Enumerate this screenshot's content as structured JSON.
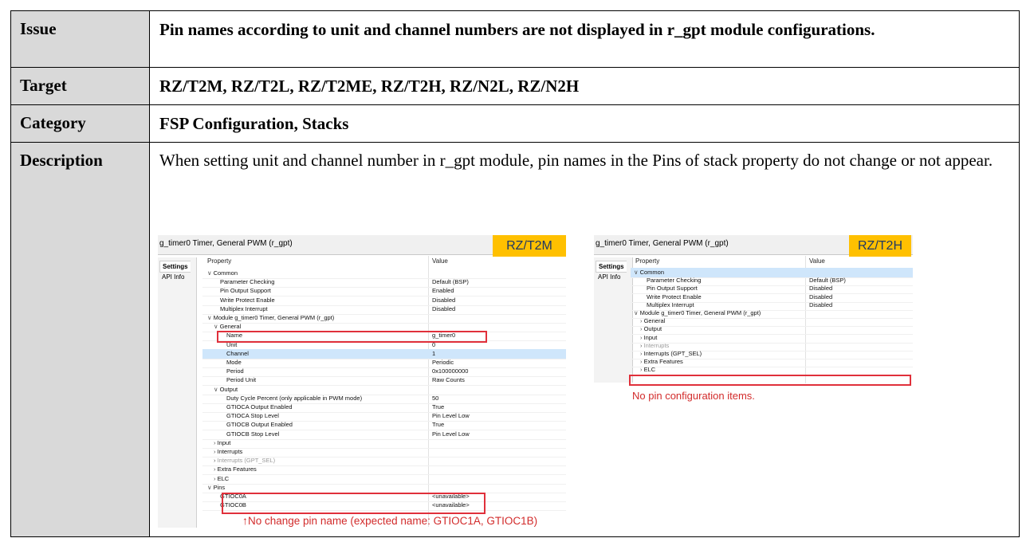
{
  "rows": {
    "issue": {
      "label": "Issue",
      "value": "Pin names according to unit and channel numbers are not displayed in r_gpt module configurations."
    },
    "target": {
      "label": "Target",
      "value": "RZ/T2M, RZ/T2L, RZ/T2ME, RZ/T2H, RZ/N2L, RZ/N2H"
    },
    "category": {
      "label": "Category",
      "value": "FSP Configuration, Stacks"
    },
    "description": {
      "label": "Description",
      "value": "When setting unit and channel number in r_gpt module, pin names in the Pins of stack property do not change or not appear."
    }
  },
  "left_panel": {
    "title": "g_timer0 Timer, General PWM (r_gpt)",
    "badge": "RZ/T2M",
    "tabs": [
      "Settings",
      "API Info"
    ],
    "col_property": "Property",
    "col_value": "Value",
    "rows": [
      {
        "indent": 0,
        "toggle": "v",
        "p": "Common",
        "v": ""
      },
      {
        "indent": 2,
        "toggle": "",
        "p": "Parameter Checking",
        "v": "Default (BSP)"
      },
      {
        "indent": 2,
        "toggle": "",
        "p": "Pin Output Support",
        "v": "Enabled"
      },
      {
        "indent": 2,
        "toggle": "",
        "p": "Write Protect Enable",
        "v": "Disabled"
      },
      {
        "indent": 2,
        "toggle": "",
        "p": "Multiplex Interrupt",
        "v": "Disabled"
      },
      {
        "indent": 0,
        "toggle": "v",
        "p": "Module g_timer0 Timer, General PWM (r_gpt)",
        "v": ""
      },
      {
        "indent": 1,
        "toggle": "v",
        "p": "General",
        "v": ""
      },
      {
        "indent": 3,
        "toggle": "",
        "p": "Name",
        "v": "g_timer0"
      },
      {
        "indent": 3,
        "toggle": "",
        "p": "Unit",
        "v": "0"
      },
      {
        "indent": 3,
        "toggle": "",
        "p": "Channel",
        "v": "1",
        "sel": true
      },
      {
        "indent": 3,
        "toggle": "",
        "p": "Mode",
        "v": "Periodic"
      },
      {
        "indent": 3,
        "toggle": "",
        "p": "Period",
        "v": "0x100000000"
      },
      {
        "indent": 3,
        "toggle": "",
        "p": "Period Unit",
        "v": "Raw Counts"
      },
      {
        "indent": 1,
        "toggle": "v",
        "p": "Output",
        "v": ""
      },
      {
        "indent": 3,
        "toggle": "",
        "p": "Duty Cycle Percent (only applicable in PWM mode)",
        "v": "50"
      },
      {
        "indent": 3,
        "toggle": "",
        "p": "GTIOCA Output Enabled",
        "v": "True"
      },
      {
        "indent": 3,
        "toggle": "",
        "p": "GTIOCA Stop Level",
        "v": "Pin Level Low"
      },
      {
        "indent": 3,
        "toggle": "",
        "p": "GTIOCB Output Enabled",
        "v": "True"
      },
      {
        "indent": 3,
        "toggle": "",
        "p": "GTIOCB Stop Level",
        "v": "Pin Level Low"
      },
      {
        "indent": 1,
        "toggle": ">",
        "p": "Input",
        "v": ""
      },
      {
        "indent": 1,
        "toggle": ">",
        "p": "Interrupts",
        "v": ""
      },
      {
        "indent": 1,
        "toggle": ">",
        "p": "Interrupts (GPT_SEL)",
        "v": "",
        "dim": true
      },
      {
        "indent": 1,
        "toggle": ">",
        "p": "Extra Features",
        "v": ""
      },
      {
        "indent": 1,
        "toggle": ">",
        "p": "ELC",
        "v": ""
      },
      {
        "indent": 0,
        "toggle": "v",
        "p": "Pins",
        "v": ""
      },
      {
        "indent": 2,
        "toggle": "",
        "p": "GTIOC0A",
        "v": "<unavailable>"
      },
      {
        "indent": 2,
        "toggle": "",
        "p": "GTIOC0B",
        "v": "<unavailable>"
      }
    ],
    "annotation": "No change pin name (expected name: GTIOC1A, GTIOC1B)"
  },
  "right_panel": {
    "title": "g_timer0 Timer, General PWM (r_gpt)",
    "badge": "RZ/T2H",
    "tabs": [
      "Settings",
      "API Info"
    ],
    "col_property": "Property",
    "col_value": "Value",
    "rows": [
      {
        "indent": 0,
        "toggle": "v",
        "p": "Common",
        "v": "",
        "sel": true
      },
      {
        "indent": 2,
        "toggle": "",
        "p": "Parameter Checking",
        "v": "Default (BSP)"
      },
      {
        "indent": 2,
        "toggle": "",
        "p": "Pin Output Support",
        "v": "Disabled"
      },
      {
        "indent": 2,
        "toggle": "",
        "p": "Write Protect Enable",
        "v": "Disabled"
      },
      {
        "indent": 2,
        "toggle": "",
        "p": "Multiplex Interrupt",
        "v": "Disabled"
      },
      {
        "indent": 0,
        "toggle": "v",
        "p": "Module g_timer0 Timer, General PWM (r_gpt)",
        "v": ""
      },
      {
        "indent": 1,
        "toggle": ">",
        "p": "General",
        "v": ""
      },
      {
        "indent": 1,
        "toggle": ">",
        "p": "Output",
        "v": ""
      },
      {
        "indent": 1,
        "toggle": ">",
        "p": "Input",
        "v": ""
      },
      {
        "indent": 1,
        "toggle": ">",
        "p": "Interrupts",
        "v": "",
        "dim": true
      },
      {
        "indent": 1,
        "toggle": ">",
        "p": "Interrupts (GPT_SEL)",
        "v": ""
      },
      {
        "indent": 1,
        "toggle": ">",
        "p": "Extra Features",
        "v": ""
      },
      {
        "indent": 1,
        "toggle": ">",
        "p": "ELC",
        "v": ""
      }
    ],
    "annotation": "No pin configuration items."
  }
}
